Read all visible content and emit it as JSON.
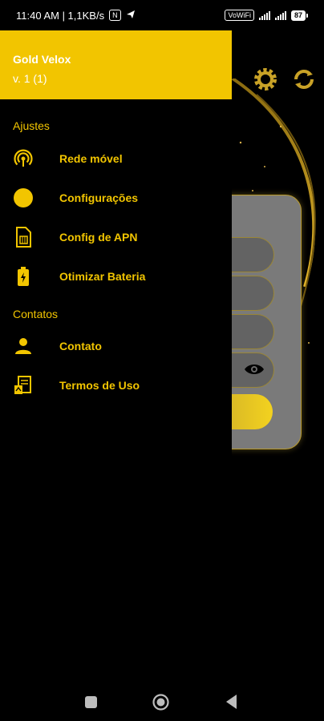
{
  "status_bar": {
    "time_speed": "11:40 AM | 1,1KB/s",
    "vowifi": "VoWiFi",
    "battery": "87"
  },
  "drawer": {
    "app_name": "Gold Velox",
    "version": "v. 1 (1)",
    "sections": [
      {
        "title": "Ajustes",
        "items": [
          {
            "label": "Rede móvel",
            "icon": "signal-broadcast-icon"
          },
          {
            "label": "Configurações",
            "icon": "circle-icon"
          },
          {
            "label": "Config de APN",
            "icon": "sim-card-icon"
          },
          {
            "label": "Otimizar Bateria",
            "icon": "battery-charging-icon"
          }
        ]
      },
      {
        "title": "Contatos",
        "items": [
          {
            "label": "Contato",
            "icon": "person-icon"
          },
          {
            "label": "Termos de Uso",
            "icon": "terms-document-icon"
          }
        ]
      }
    ]
  },
  "colors": {
    "accent": "#f2c500",
    "background": "#000000",
    "header_text": "#ffffff"
  }
}
